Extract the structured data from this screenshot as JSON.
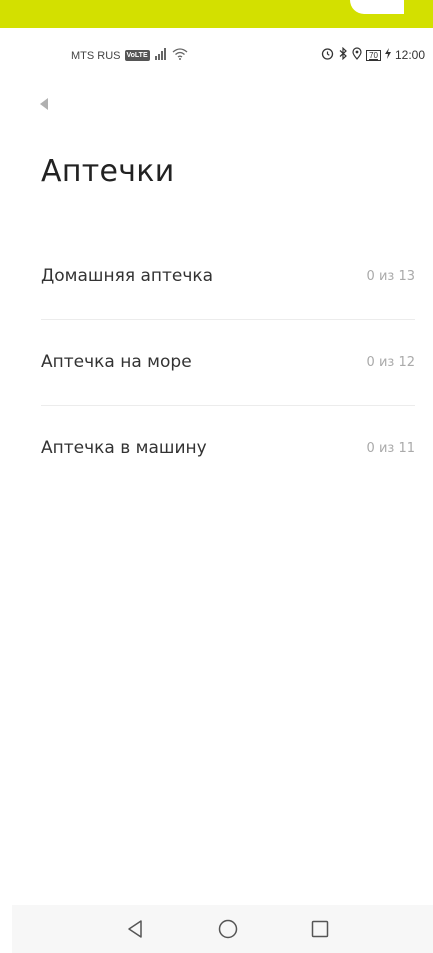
{
  "status_bar": {
    "carrier": "MTS RUS",
    "volte": "VoLTE",
    "battery": "70",
    "time": "12:00"
  },
  "title": "Аптечки",
  "kits": [
    {
      "name": "Домашняя аптечка",
      "count": "0 из 13"
    },
    {
      "name": "Аптечка на море",
      "count": "0 из 12"
    },
    {
      "name": "Аптечка в машину",
      "count": "0 из 11"
    }
  ],
  "colors": {
    "banner": "#d3e000",
    "title": "#222222",
    "count": "#aaaaaa"
  },
  "icons": {
    "back": "back-arrow-icon",
    "nav_back": "triangle-back-icon",
    "nav_home": "circle-home-icon",
    "nav_recent": "square-recent-icon"
  }
}
